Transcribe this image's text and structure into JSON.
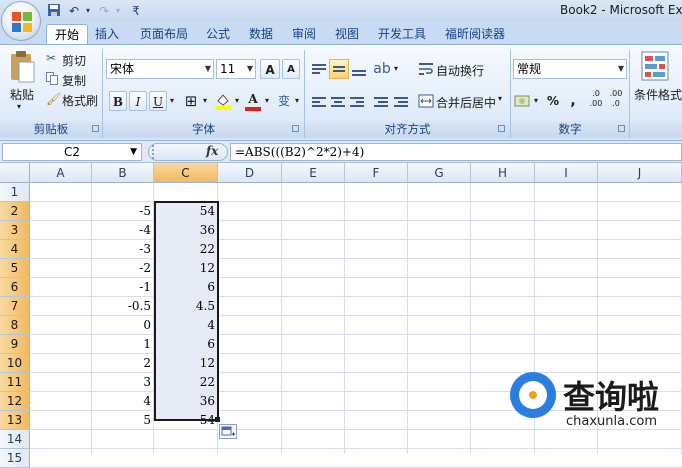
{
  "window": {
    "title": "Book2 - Microsoft Ex"
  },
  "tabs": [
    "开始",
    "插入",
    "页面布局",
    "公式",
    "数据",
    "审阅",
    "视图",
    "开发工具",
    "福昕阅读器"
  ],
  "ribbon": {
    "clipboard": {
      "paste": "粘贴",
      "cut": "剪切",
      "copy": "复制",
      "format_painter": "格式刷",
      "label": "剪贴板"
    },
    "font": {
      "name": "宋体",
      "size": "11",
      "bold": "B",
      "italic": "I",
      "underline": "U",
      "grow": "A",
      "shrink": "A",
      "font_color": "A",
      "phonetic": "变",
      "label": "字体"
    },
    "alignment": {
      "wrap_text": "自动换行",
      "merge_center": "合并后居中",
      "label": "对齐方式"
    },
    "number": {
      "format": "常规",
      "percent": "%",
      "comma": ",",
      "inc_decimal": ".0 .00",
      "dec_decimal": ".00 .0",
      "label": "数字"
    },
    "styles": {
      "conditional": "条件格式"
    }
  },
  "formula_bar": {
    "name_box": "C2",
    "fx": "fx",
    "formula": "=ABS(((B2)^2*2)+4)"
  },
  "columns": [
    "A",
    "B",
    "C",
    "D",
    "E",
    "F",
    "G",
    "H",
    "I",
    "J"
  ],
  "rows": [
    "1",
    "2",
    "3",
    "4",
    "5",
    "6",
    "7",
    "8",
    "9",
    "10",
    "11",
    "12",
    "13",
    "14",
    "15"
  ],
  "cells": {
    "B": [
      "",
      "-5",
      "-4",
      "-3",
      "-2",
      "-1",
      "-0.5",
      "0",
      "1",
      "2",
      "3",
      "4",
      "5"
    ],
    "C": [
      "",
      "54",
      "36",
      "22",
      "12",
      "6",
      "4.5",
      "4",
      "6",
      "12",
      "22",
      "36",
      "54"
    ]
  },
  "selection": {
    "column": "C",
    "first_row": 2,
    "last_row": 13
  },
  "watermark": {
    "text": "查询啦",
    "url": "chaxunla.com"
  }
}
